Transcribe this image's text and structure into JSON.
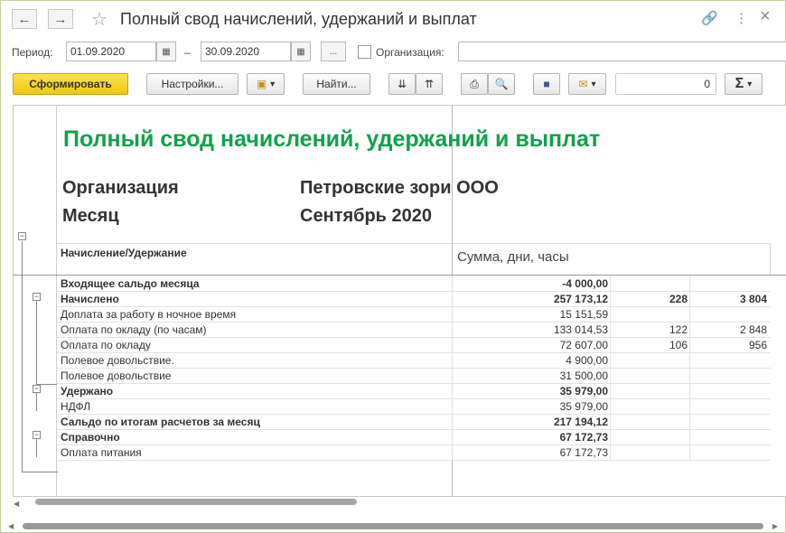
{
  "window": {
    "title": "Полный свод начислений, удержаний и выплат",
    "back_icon": "←",
    "forward_icon": "→",
    "star_icon": "☆",
    "link_icon": "🔗",
    "menu_icon": "⋮",
    "close_icon": "×"
  },
  "filters": {
    "period_label": "Период:",
    "date_from": "01.09.2020",
    "dash": "–",
    "date_to": "30.09.2020",
    "dots_label": "...",
    "org_label": "Организация:",
    "org_value": ""
  },
  "toolbar": {
    "generate_label": "Сформировать",
    "settings_label": "Настройки...",
    "find_label": "Найти...",
    "sum_value": "0",
    "sigma": "Σ",
    "dropdown": "▾"
  },
  "report": {
    "title": "Полный свод начислений, удержаний и выплат",
    "org_label": "Организация",
    "org_value": "Петровские зори ООО",
    "month_label": "Месяц",
    "month_value": "Сентябрь 2020",
    "col_header": "Начисление/Удержание",
    "col_sum_header": "Сумма, дни, часы",
    "rows": [
      {
        "name": "Входящее сальдо месяца",
        "sum": "-4 000,00",
        "days": "",
        "hours": "",
        "bold": true
      },
      {
        "name": "Начислено",
        "sum": "257 173,12",
        "days": "228",
        "hours": "3 804",
        "bold": true
      },
      {
        "name": "Доплата за работу в ночное время",
        "sum": "15 151,59",
        "days": "",
        "hours": "",
        "bold": false
      },
      {
        "name": "Оплата по окладу (по часам)",
        "sum": "133 014,53",
        "days": "122",
        "hours": "2 848",
        "bold": false
      },
      {
        "name": "Оплата по окладу",
        "sum": "72 607,00",
        "days": "106",
        "hours": "956",
        "bold": false
      },
      {
        "name": "Полевое довольствие.",
        "sum": "4 900,00",
        "days": "",
        "hours": "",
        "bold": false
      },
      {
        "name": "Полевое довольствие",
        "sum": "31 500,00",
        "days": "",
        "hours": "",
        "bold": false
      },
      {
        "name": "Удержано",
        "sum": "35 979,00",
        "days": "",
        "hours": "",
        "bold": true
      },
      {
        "name": "НДФЛ",
        "sum": "35 979,00",
        "days": "",
        "hours": "",
        "bold": false
      },
      {
        "name": "Сальдо по итогам расчетов за месяц",
        "sum": "217 194,12",
        "days": "",
        "hours": "",
        "bold": true
      },
      {
        "name": "Справочно",
        "sum": "67 172,73",
        "days": "",
        "hours": "",
        "bold": true
      },
      {
        "name": "Оплата питания",
        "sum": "67 172,73",
        "days": "",
        "hours": "",
        "bold": false
      }
    ]
  },
  "colors": {
    "title_green": "#11a14b",
    "primary_yellow": "#f5d52a"
  }
}
